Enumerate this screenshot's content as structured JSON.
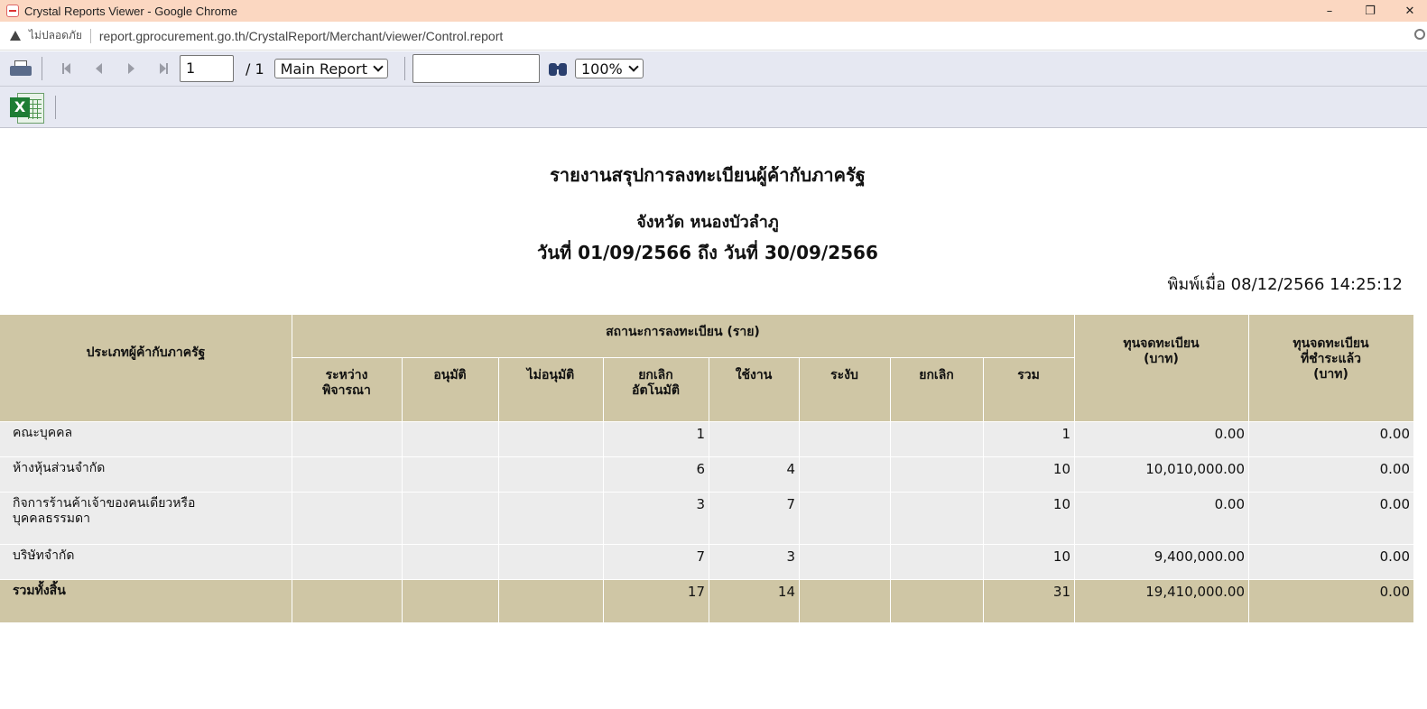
{
  "window": {
    "title": "Crystal Reports Viewer - Google Chrome",
    "minimize": "–",
    "restore": "❐",
    "close": "✕"
  },
  "address": {
    "security": "ไม่ปลอดภัย",
    "url": "report.gprocurement.go.th/CrystalReport/Merchant/viewer/Control.report"
  },
  "toolbar": {
    "page_value": "1",
    "page_total": "/ 1",
    "report_select": "Main Report",
    "search_value": "",
    "zoom": "100%"
  },
  "report": {
    "title": "รายงานสรุปการลงทะเบียนผู้ค้ากับภาครัฐ",
    "province": "จังหวัด หนองบัวลำภู",
    "date_range": "วันที่ 01/09/2566 ถึง วันที่ 30/09/2566",
    "printed_at": "พิมพ์เมื่อ 08/12/2566  14:25:12"
  },
  "table": {
    "col_type": "ประเภทผู้ค้ากับภาครัฐ",
    "group_status": "สถานะการลงทะเบียน (ราย)",
    "col_pending": "ระหว่าง\nพิจารณา",
    "col_approved": "อนุมัติ",
    "col_rejected": "ไม่อนุมัติ",
    "col_auto_cancel": "ยกเลิก\nอัตโนมัติ",
    "col_active": "ใช้งาน",
    "col_suspended": "ระงับ",
    "col_cancelled": "ยกเลิก",
    "col_total": "รวม",
    "col_capital": "ทุนจดทะเบียน\n(บาท)",
    "col_paid_capital": "ทุนจดทะเบียน\nที่ชำระแล้ว\n(บาท)",
    "rows": [
      {
        "type": "คณะบุคคล",
        "pending": "",
        "approved": "",
        "rejected": "",
        "auto_cancel": "1",
        "active": "",
        "suspended": "",
        "cancelled": "",
        "total": "1",
        "capital": "0.00",
        "paid_capital": "0.00"
      },
      {
        "type": "ห้างหุ้นส่วนจำกัด",
        "pending": "",
        "approved": "",
        "rejected": "",
        "auto_cancel": "6",
        "active": "4",
        "suspended": "",
        "cancelled": "",
        "total": "10",
        "capital": "10,010,000.00",
        "paid_capital": "0.00"
      },
      {
        "type": "กิจการร้านค้าเจ้าของคนเดียวหรือ\nบุคคลธรรมดา",
        "pending": "",
        "approved": "",
        "rejected": "",
        "auto_cancel": "3",
        "active": "7",
        "suspended": "",
        "cancelled": "",
        "total": "10",
        "capital": "0.00",
        "paid_capital": "0.00"
      },
      {
        "type": "บริษัทจำกัด",
        "pending": "",
        "approved": "",
        "rejected": "",
        "auto_cancel": "7",
        "active": "3",
        "suspended": "",
        "cancelled": "",
        "total": "10",
        "capital": "9,400,000.00",
        "paid_capital": "0.00"
      }
    ],
    "total_row": {
      "type": "รวมทั้งสิ้น",
      "auto_cancel": "17",
      "active": "14",
      "total": "31",
      "capital": "19,410,000.00",
      "paid_capital": "0.00"
    }
  }
}
